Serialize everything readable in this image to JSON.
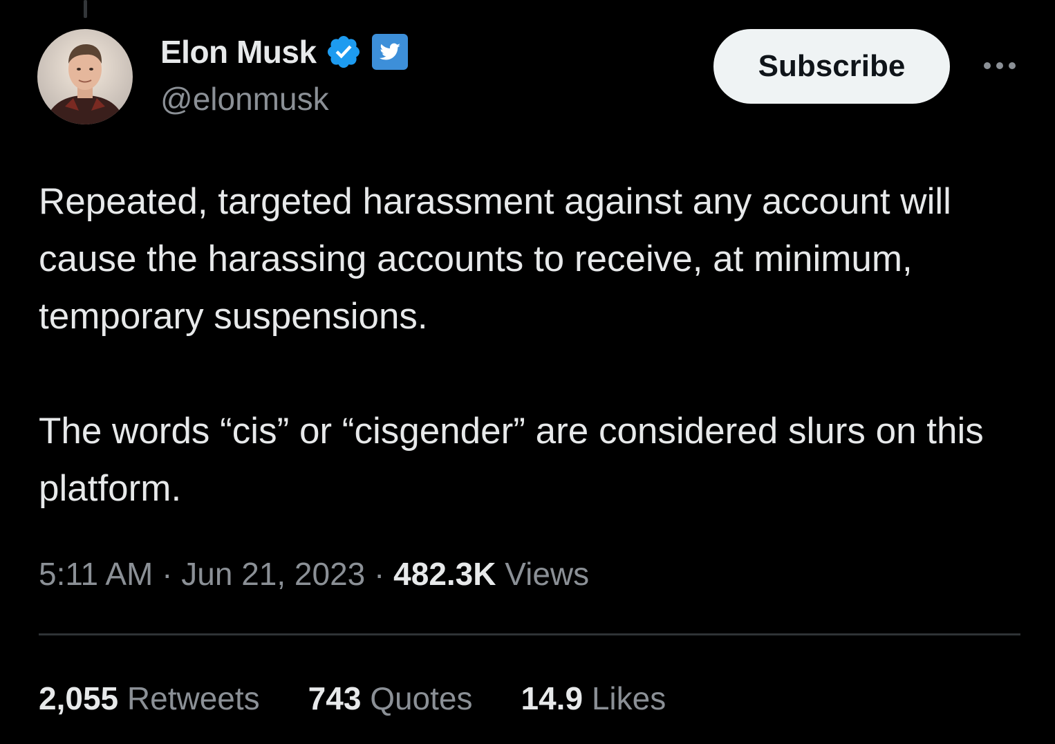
{
  "author": {
    "display_name": "Elon Musk",
    "handle": "@elonmusk",
    "avatar_icon": "profile-photo",
    "verified_icon": "verified-badge-icon",
    "badge_icon": "twitter-bird-icon"
  },
  "header": {
    "subscribe_label": "Subscribe",
    "more_icon": "more-horizontal-icon"
  },
  "tweet": {
    "paragraphs": [
      "Repeated, targeted harassment against any account will cause the harassing accounts to receive, at minimum, temporary suspensions.",
      "The words “cis” or “cisgender” are considered slurs on this platform."
    ],
    "time": "5:11 AM",
    "date": "Jun 21, 2023",
    "separator": "·",
    "views_count": "482.3K",
    "views_label": "Views"
  },
  "stats": {
    "retweets_count": "2,055",
    "retweets_label": "Retweets",
    "quotes_count": "743",
    "quotes_label": "Quotes",
    "likes_count": "14.9",
    "likes_label": "Likes"
  },
  "colors": {
    "background": "#000000",
    "primary_text": "#e7e9ea",
    "secondary_text": "#8b9096",
    "verified_blue": "#1d9bf0",
    "divider": "#2f3336"
  }
}
